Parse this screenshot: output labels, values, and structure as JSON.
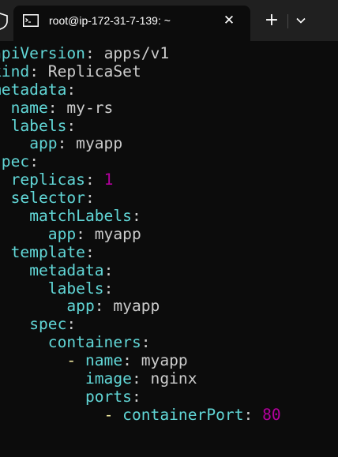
{
  "tab": {
    "title": "root@ip-172-31-7-139: ~",
    "close_glyph": "✕",
    "new_tab_glyph": "+"
  },
  "icons": {
    "shield": "shield-icon",
    "terminal": "terminal-icon",
    "close": "close-icon",
    "new_tab": "plus-icon",
    "dropdown": "chevron-down-icon"
  },
  "colors": {
    "background": "#0c0c0c",
    "tabbar": "#202020",
    "key": "#61d6d6",
    "text": "#cccccc",
    "number": "#b4009e",
    "dash": "#f9f1a5"
  },
  "terminal": {
    "lines": [
      [
        {
          "t": "apiVersion",
          "c": "k"
        },
        {
          "t": ": ",
          "c": "p"
        },
        {
          "t": "apps/v1",
          "c": "v"
        }
      ],
      [
        {
          "t": "kind",
          "c": "k"
        },
        {
          "t": ": ",
          "c": "p"
        },
        {
          "t": "ReplicaSet",
          "c": "v"
        }
      ],
      [
        {
          "t": "metadata",
          "c": "k"
        },
        {
          "t": ":",
          "c": "p"
        }
      ],
      [
        {
          "t": "  ",
          "c": "p"
        },
        {
          "t": "name",
          "c": "k"
        },
        {
          "t": ": ",
          "c": "p"
        },
        {
          "t": "my-rs",
          "c": "v"
        }
      ],
      [
        {
          "t": "  ",
          "c": "p"
        },
        {
          "t": "labels",
          "c": "k"
        },
        {
          "t": ":",
          "c": "p"
        }
      ],
      [
        {
          "t": "    ",
          "c": "p"
        },
        {
          "t": "app",
          "c": "k"
        },
        {
          "t": ": ",
          "c": "p"
        },
        {
          "t": "myapp",
          "c": "v"
        }
      ],
      [
        {
          "t": "spec",
          "c": "k"
        },
        {
          "t": ":",
          "c": "p"
        }
      ],
      [
        {
          "t": "  ",
          "c": "p"
        },
        {
          "t": "replicas",
          "c": "k"
        },
        {
          "t": ": ",
          "c": "p"
        },
        {
          "t": "1",
          "c": "n"
        }
      ],
      [
        {
          "t": "  ",
          "c": "p"
        },
        {
          "t": "selector",
          "c": "k"
        },
        {
          "t": ":",
          "c": "p"
        }
      ],
      [
        {
          "t": "    ",
          "c": "p"
        },
        {
          "t": "matchLabels",
          "c": "k"
        },
        {
          "t": ":",
          "c": "p"
        }
      ],
      [
        {
          "t": "      ",
          "c": "p"
        },
        {
          "t": "app",
          "c": "k"
        },
        {
          "t": ": ",
          "c": "p"
        },
        {
          "t": "myapp",
          "c": "v"
        }
      ],
      [
        {
          "t": "  ",
          "c": "p"
        },
        {
          "t": "template",
          "c": "k"
        },
        {
          "t": ":",
          "c": "p"
        }
      ],
      [
        {
          "t": "    ",
          "c": "p"
        },
        {
          "t": "metadata",
          "c": "k"
        },
        {
          "t": ":",
          "c": "p"
        }
      ],
      [
        {
          "t": "      ",
          "c": "p"
        },
        {
          "t": "labels",
          "c": "k"
        },
        {
          "t": ":",
          "c": "p"
        }
      ],
      [
        {
          "t": "        ",
          "c": "p"
        },
        {
          "t": "app",
          "c": "k"
        },
        {
          "t": ": ",
          "c": "p"
        },
        {
          "t": "myapp",
          "c": "v"
        }
      ],
      [
        {
          "t": "    ",
          "c": "p"
        },
        {
          "t": "spec",
          "c": "k"
        },
        {
          "t": ":",
          "c": "p"
        }
      ],
      [
        {
          "t": "      ",
          "c": "p"
        },
        {
          "t": "containers",
          "c": "k"
        },
        {
          "t": ":",
          "c": "p"
        }
      ],
      [
        {
          "t": "        ",
          "c": "p"
        },
        {
          "t": "- ",
          "c": "d"
        },
        {
          "t": "name",
          "c": "k"
        },
        {
          "t": ": ",
          "c": "p"
        },
        {
          "t": "myapp",
          "c": "v"
        }
      ],
      [
        {
          "t": "          ",
          "c": "p"
        },
        {
          "t": "image",
          "c": "k"
        },
        {
          "t": ": ",
          "c": "p"
        },
        {
          "t": "nginx",
          "c": "v"
        }
      ],
      [
        {
          "t": "          ",
          "c": "p"
        },
        {
          "t": "ports",
          "c": "k"
        },
        {
          "t": ":",
          "c": "p"
        }
      ],
      [
        {
          "t": "            ",
          "c": "p"
        },
        {
          "t": "- ",
          "c": "d"
        },
        {
          "t": "containerPort",
          "c": "k"
        },
        {
          "t": ": ",
          "c": "p"
        },
        {
          "t": "80",
          "c": "n"
        }
      ]
    ]
  }
}
